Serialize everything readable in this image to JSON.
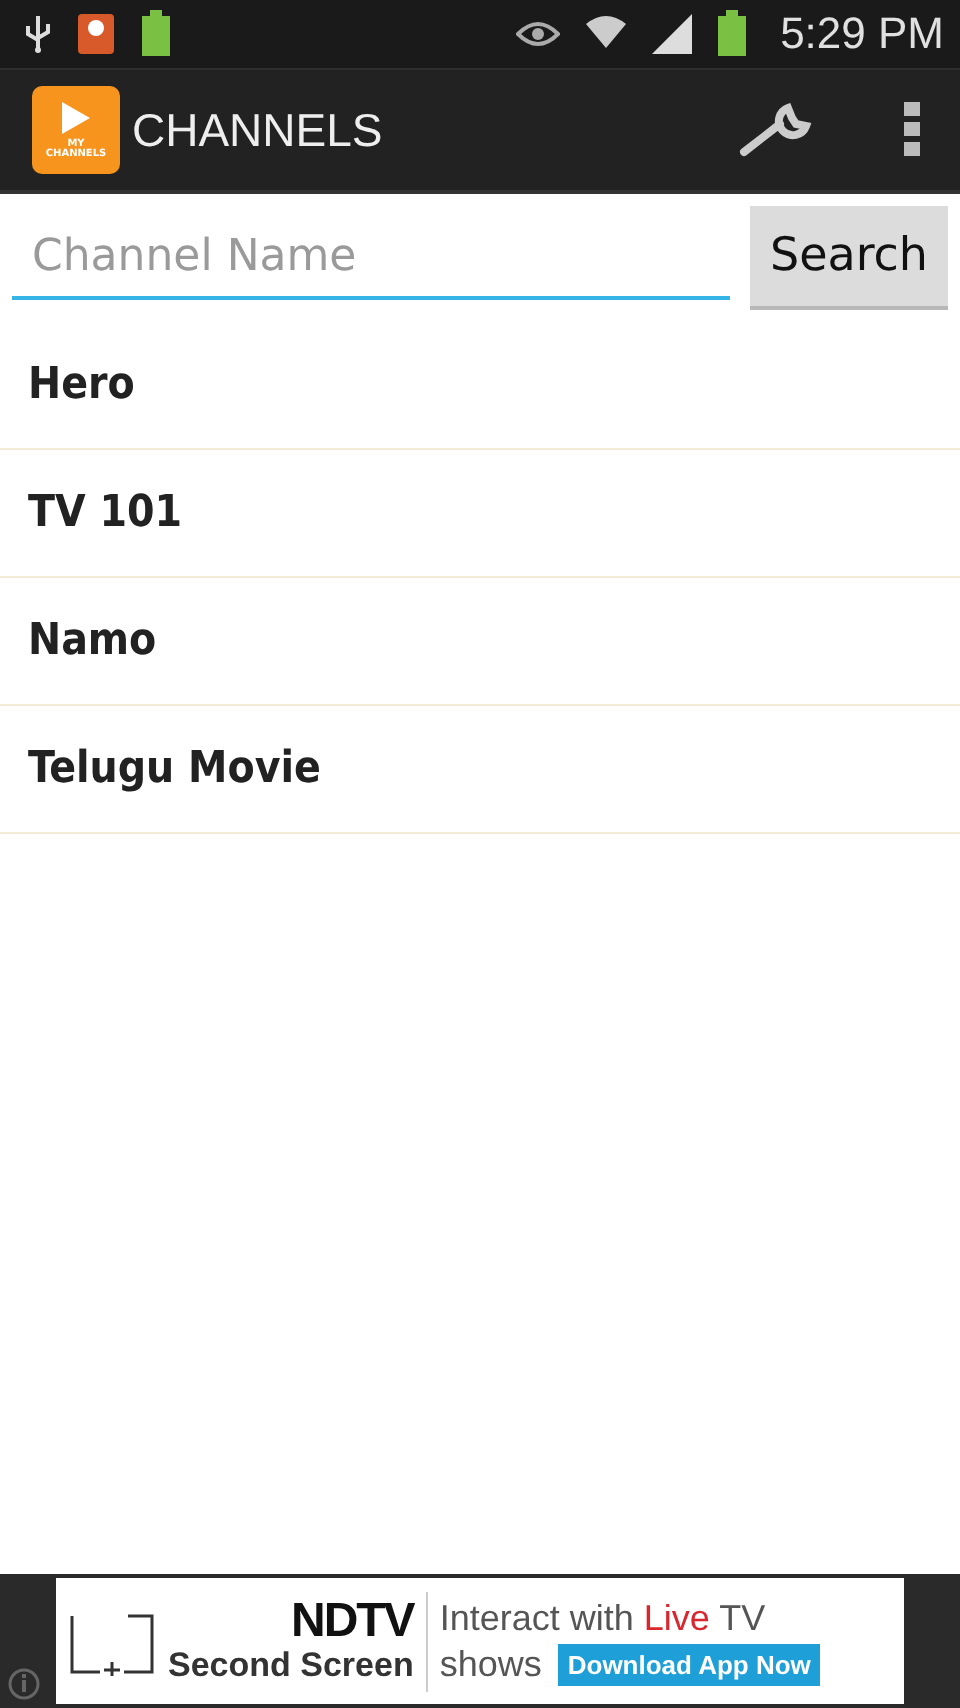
{
  "status_bar": {
    "time": "5:29 PM"
  },
  "action_bar": {
    "logo_text": "MY CHANNELS",
    "title": "CHANNELS"
  },
  "search": {
    "placeholder": "Channel Name",
    "button": "Search"
  },
  "channels": [
    {
      "name": "Hero"
    },
    {
      "name": "TV 101"
    },
    {
      "name": "Namo"
    },
    {
      "name": "Telugu Movie"
    }
  ],
  "ad": {
    "brand": "NDTV",
    "product": "Second Screen",
    "line_start": "Interact with",
    "line_highlight": "Live",
    "line_end": "TV",
    "line_2": "shows",
    "button": "Download App Now"
  }
}
